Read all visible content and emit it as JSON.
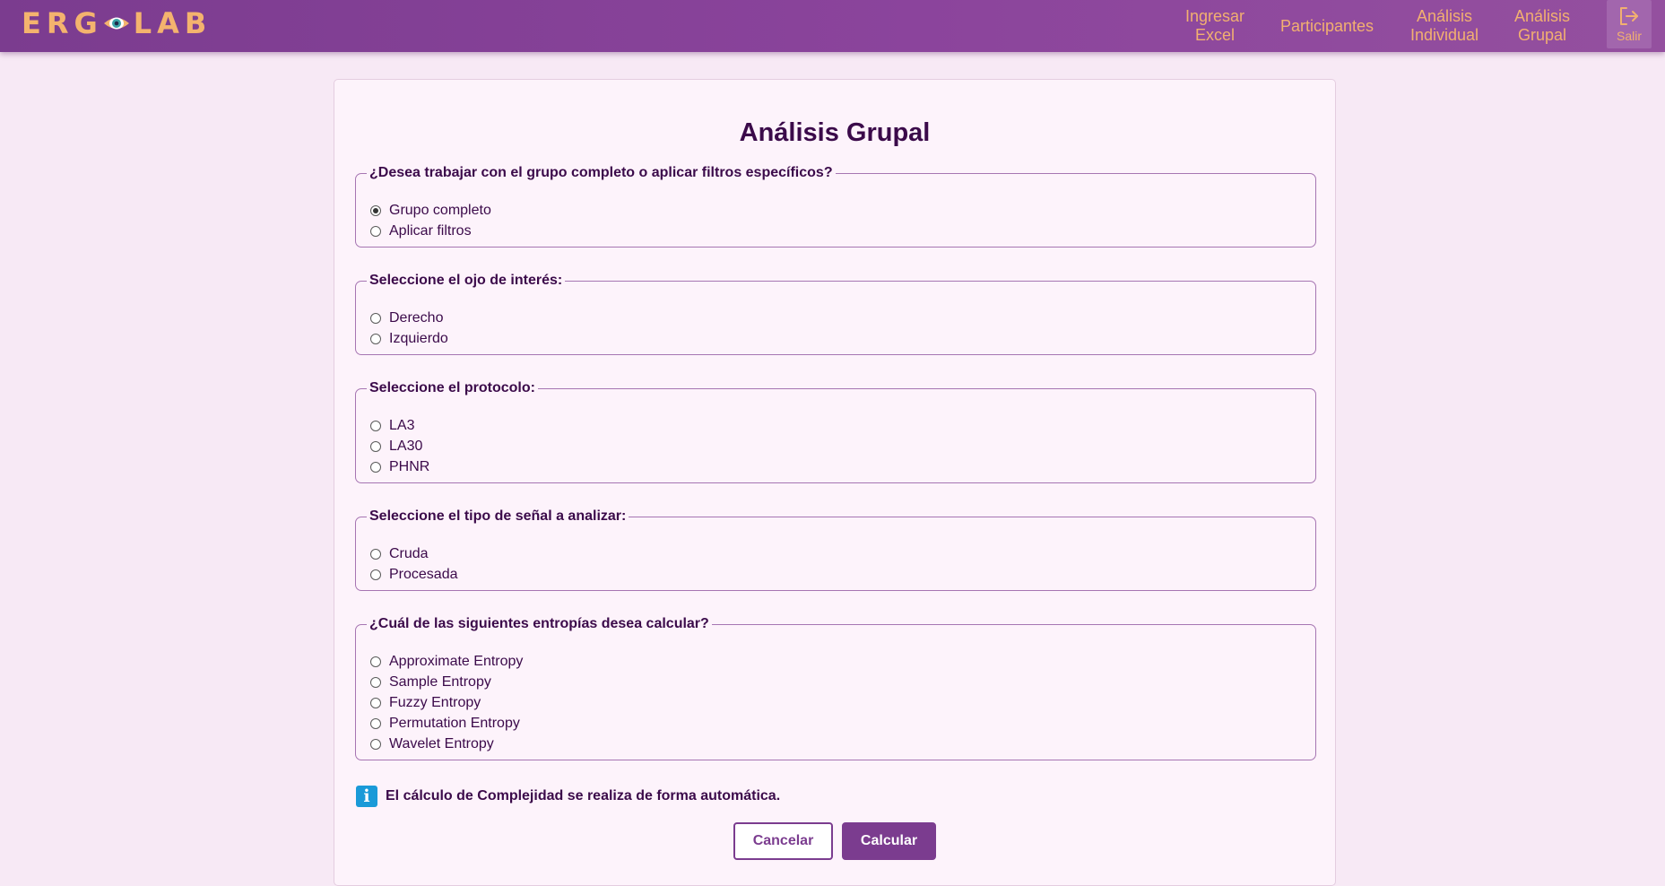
{
  "app": {
    "logo_left": "ERG",
    "logo_right": "LAB"
  },
  "nav": {
    "items": [
      {
        "line1": "Ingresar",
        "line2": "Excel"
      },
      {
        "line1": "Participantes",
        "line2": ""
      },
      {
        "line1": "Análisis",
        "line2": "Individual"
      },
      {
        "line1": "Análisis",
        "line2": "Grupal"
      }
    ],
    "exit_label": "Salir"
  },
  "colors": {
    "brand": "#7b3c8f",
    "accent": "#f2b070",
    "info": "#1a9ad8"
  },
  "page": {
    "title": "Análisis Grupal"
  },
  "form": {
    "group": {
      "legend": "¿Desea trabajar con el grupo completo o aplicar filtros específicos?",
      "options": [
        "Grupo completo",
        "Aplicar filtros"
      ],
      "selected": "Grupo completo"
    },
    "eye": {
      "legend": "Seleccione el ojo de interés:",
      "options": [
        "Derecho",
        "Izquierdo"
      ],
      "selected": ""
    },
    "protocol": {
      "legend": "Seleccione el protocolo:",
      "options": [
        "LA3",
        "LA30",
        "PHNR"
      ],
      "selected": ""
    },
    "signal": {
      "legend": "Seleccione el tipo de señal a analizar:",
      "options": [
        "Cruda",
        "Procesada"
      ],
      "selected": ""
    },
    "entropy": {
      "legend": "¿Cuál de las siguientes entropías desea calcular?",
      "options": [
        "Approximate Entropy",
        "Sample Entropy",
        "Fuzzy Entropy",
        "Permutation Entropy",
        "Wavelet Entropy"
      ],
      "selected": ""
    }
  },
  "note": {
    "text": "El cálculo de Complejidad se realiza de forma automática.",
    "icon": "info-icon"
  },
  "buttons": {
    "cancel": "Cancelar",
    "calculate": "Calcular"
  }
}
